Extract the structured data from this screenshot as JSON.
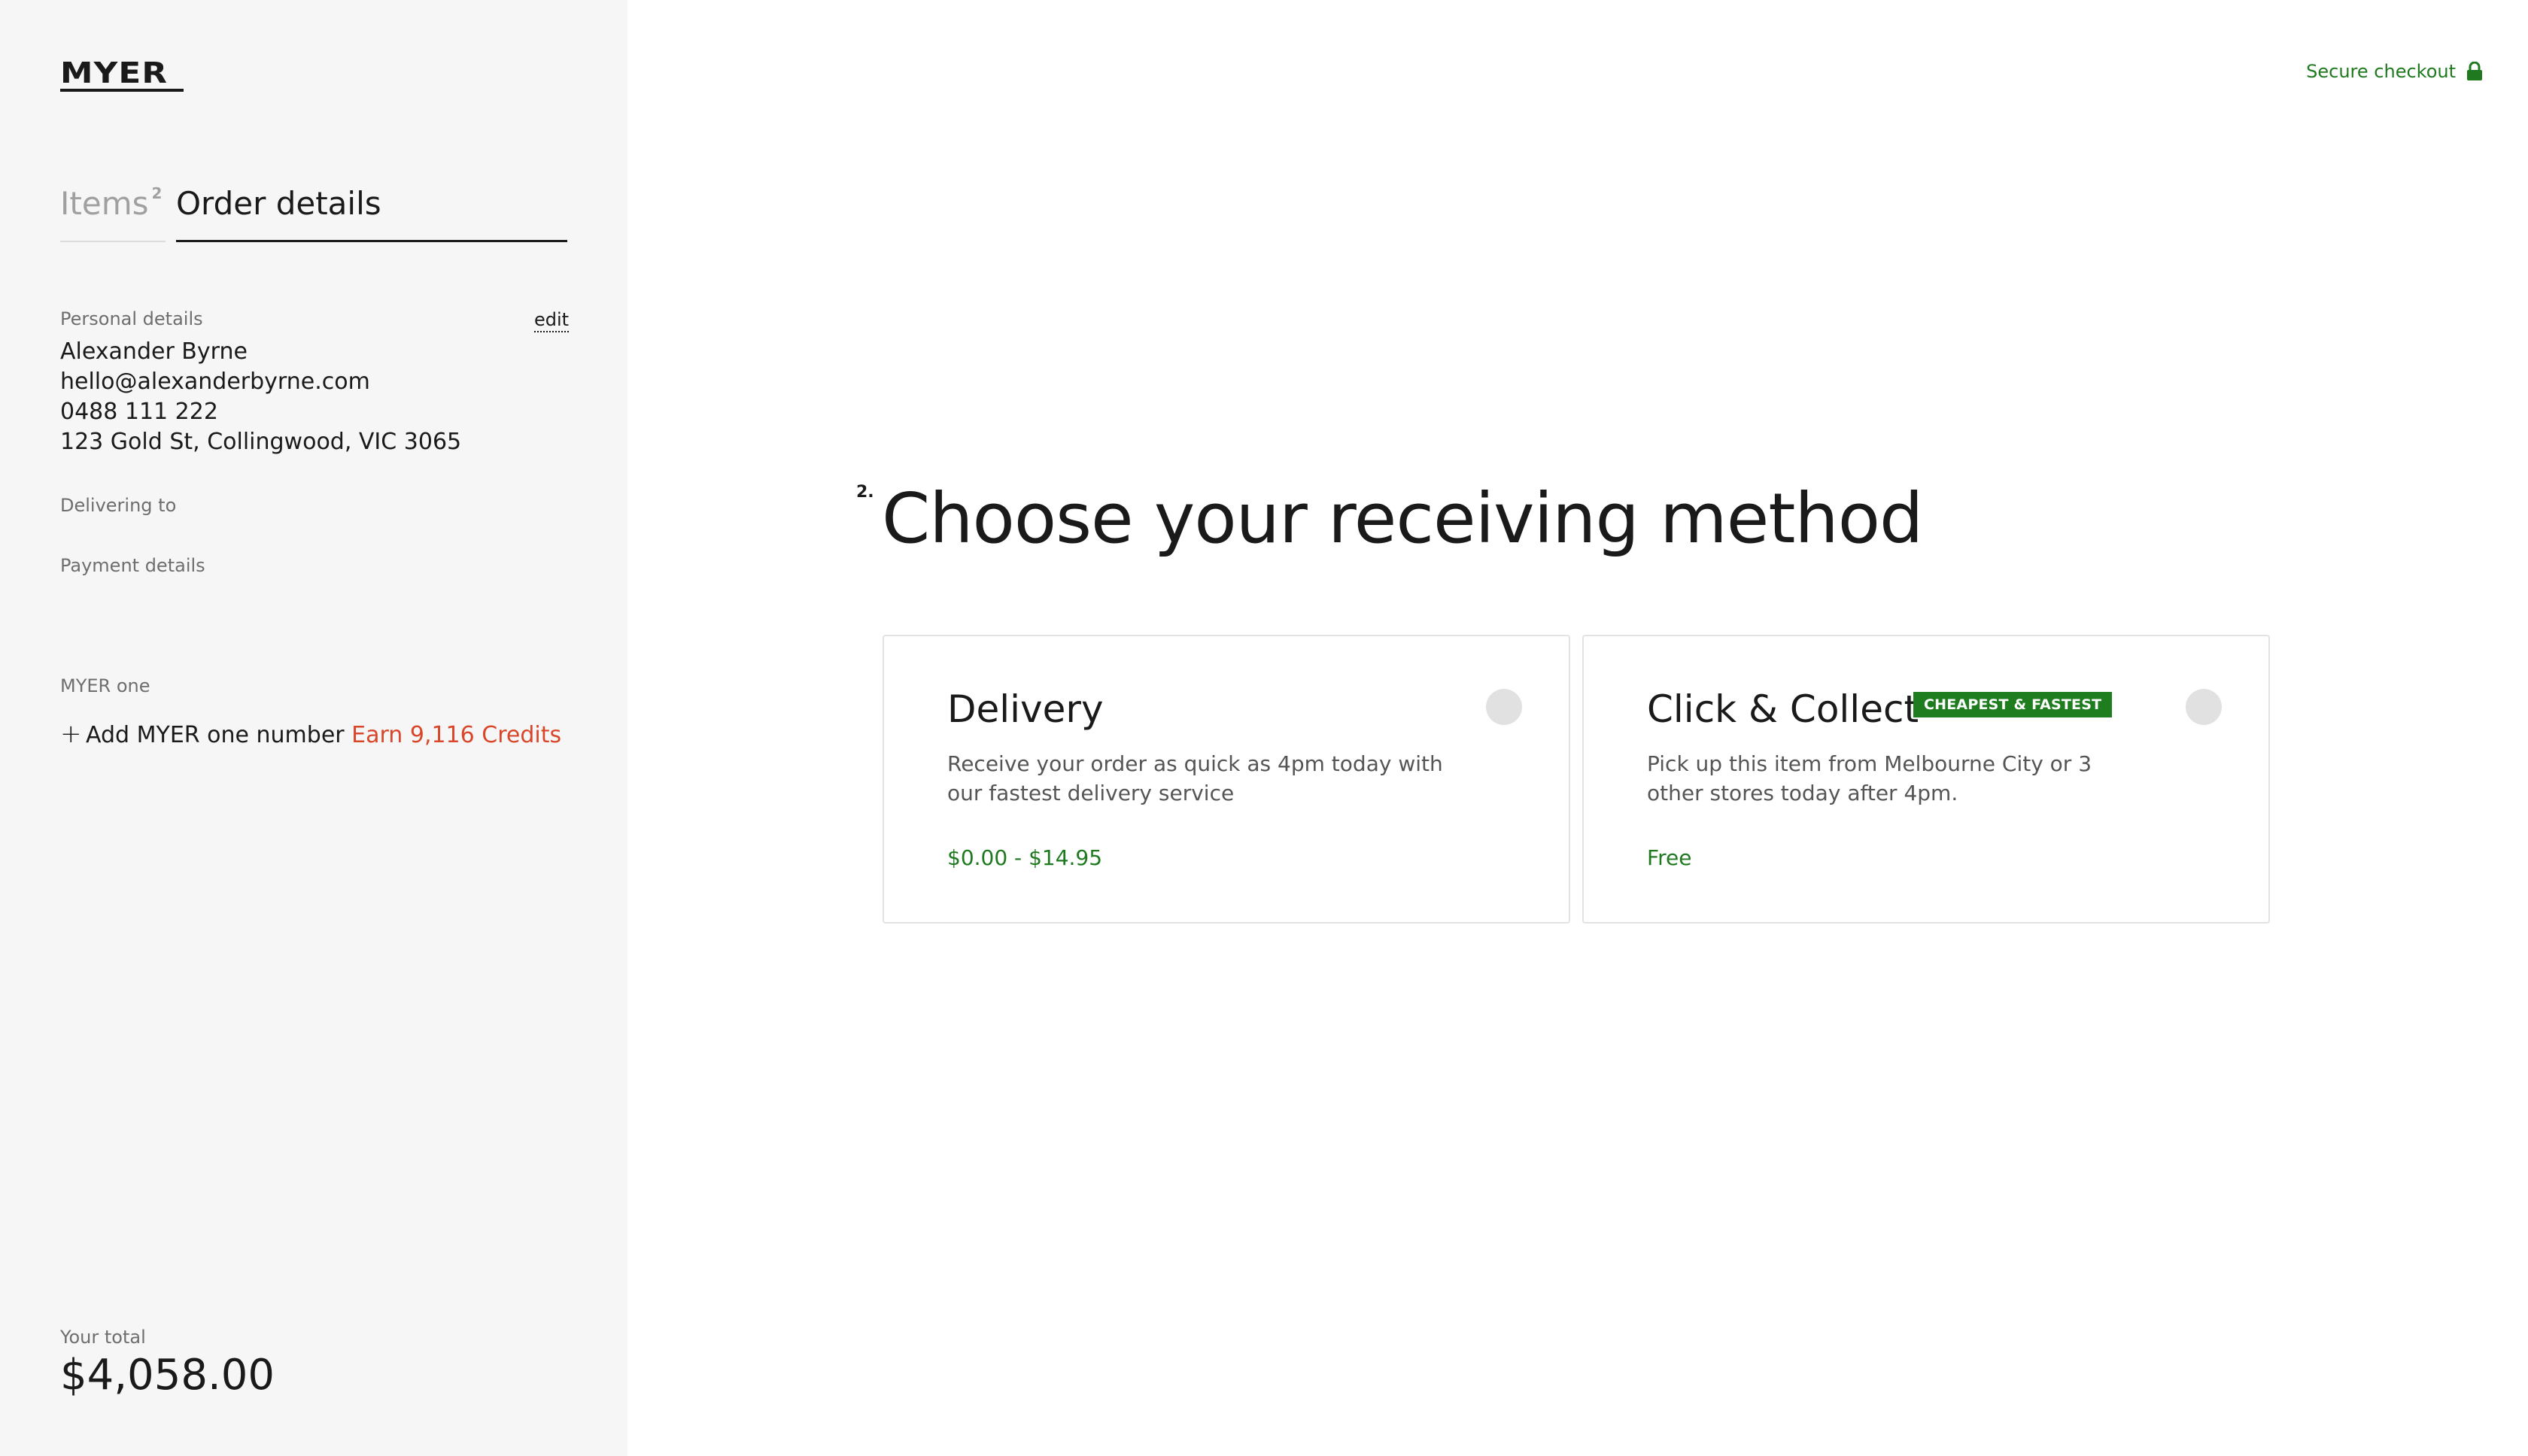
{
  "brand": {
    "logo_text": "MYER"
  },
  "header": {
    "secure_label": "Secure checkout"
  },
  "tabs": {
    "items_label": "Items",
    "items_count": "2",
    "order_label": "Order details"
  },
  "sidebar": {
    "personal_label": "Personal details",
    "edit_label": "edit",
    "personal": {
      "name": "Alexander Byrne",
      "email": "hello@alexanderbyrne.com",
      "phone": "0488 111 222",
      "address": "123 Gold St, Collingwood, VIC 3065"
    },
    "delivering_label": "Delivering to",
    "payment_label": "Payment details",
    "myer_one_label": "MYER one",
    "add_myer_one": "Add MYER one number",
    "earn_credits": "Earn 9,116 Credits",
    "total_label": "Your total",
    "total_value": "$4,058.00"
  },
  "main": {
    "step_number": "2.",
    "heading": "Choose your receiving method",
    "options": [
      {
        "title": "Delivery",
        "description": "Receive your order as quick as 4pm today with our fastest delivery service",
        "price": "$0.00 - $14.95"
      },
      {
        "title": "Click & Collect",
        "badge": "CHEAPEST & FASTEST",
        "description": "Pick up this item from Melbourne City or 3 other stores today after 4pm.",
        "price": "Free"
      }
    ]
  },
  "colors": {
    "accent_green": "#1f7a1f",
    "badge_green": "#1e7d1e",
    "earn_orange": "#d9472b",
    "sidebar_bg": "#f6f6f6"
  },
  "icons": {
    "lock": "lock-icon",
    "plus": "plus-icon"
  }
}
